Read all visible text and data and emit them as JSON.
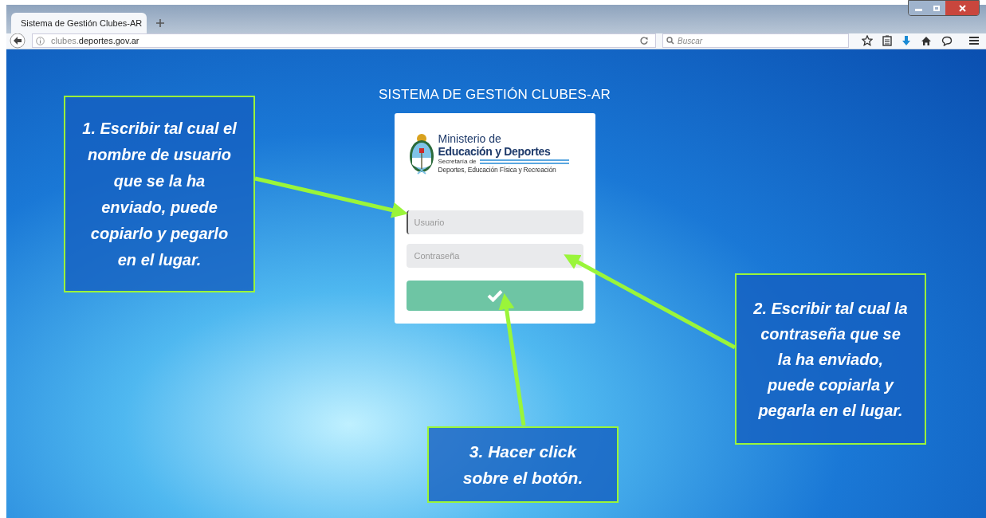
{
  "browser": {
    "tab": {
      "title": "Sistema de Gestión Clubes-AR",
      "selected": true
    },
    "url_prefix": "clubes.",
    "url_domain": "deportes.gov.ar",
    "search": {
      "placeholder": "Buscar"
    }
  },
  "page": {
    "title": "SISTEMA DE GESTIÓN CLUBES-AR",
    "logo": {
      "line_1": "Ministerio de",
      "line_2": "Educación y Deportes",
      "line_3": "Secretaría de",
      "line_4": "Deportes, Educación Física y Recreación"
    },
    "fields": [
      {
        "placeholder": "Usuario",
        "focused": true
      },
      {
        "placeholder": "Contraseña",
        "focused": false
      }
    ]
  },
  "callouts": [
    {
      "text": "1. Escribir tal cual el nombre de usuario que se la ha enviado, puede copiarlo y pegarlo en el lugar."
    },
    {
      "text": "2. Escribir tal cual la contraseña que se la ha enviado, puede copiarla y pegarla en el lugar."
    },
    {
      "text": "3. Hacer click sobre el botón."
    }
  ]
}
